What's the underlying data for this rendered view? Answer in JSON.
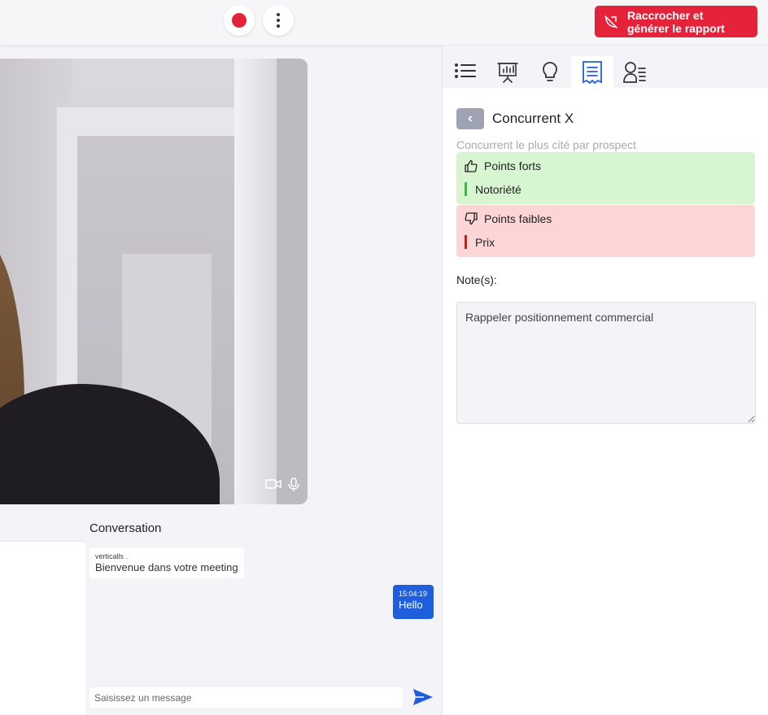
{
  "topbar": {
    "record_icon": "record-dot-icon",
    "more_icon": "kebab-menu-icon",
    "hangup": {
      "line1": "Raccrocher et",
      "line2": "générer le rapport",
      "icon": "phone-hangup-icon",
      "color": "#e4233b"
    }
  },
  "video": {
    "camera_icon": "camera-icon",
    "mic_icon": "microphone-icon"
  },
  "conversation": {
    "title": "Conversation",
    "messages": [
      {
        "sender": "verticalls .",
        "text": "Bienvenue dans votre meeting"
      },
      {
        "time": "15:04:19",
        "text": "Hello"
      }
    ],
    "input_placeholder": "Saisissez un message",
    "send_icon": "send-icon",
    "accent": "#1f5fde"
  },
  "panel": {
    "tabs": [
      {
        "icon": "list-icon"
      },
      {
        "icon": "presentation-board-icon"
      },
      {
        "icon": "lightbulb-icon"
      },
      {
        "icon": "receipt-document-icon",
        "active": true
      },
      {
        "icon": "contact-list-icon"
      }
    ],
    "back_icon": "chevron-left-icon",
    "title": "Concurrent X",
    "subtitle": "Concurrent le plus cité par prospect",
    "strengths": {
      "label": "Points forts",
      "icon": "thumbs-up-icon",
      "items": [
        "Notoriété"
      ],
      "bar_color": "#3fb544",
      "bg": "#d8f5d2"
    },
    "weaknesses": {
      "label": "Points faibles",
      "icon": "thumbs-down-icon",
      "items": [
        "Prix"
      ],
      "bar_color": "#c81e1e",
      "bg": "#fcd6d6"
    },
    "notes_label": "Note(s):",
    "notes_value": "Rappeler positionnement commercial"
  }
}
